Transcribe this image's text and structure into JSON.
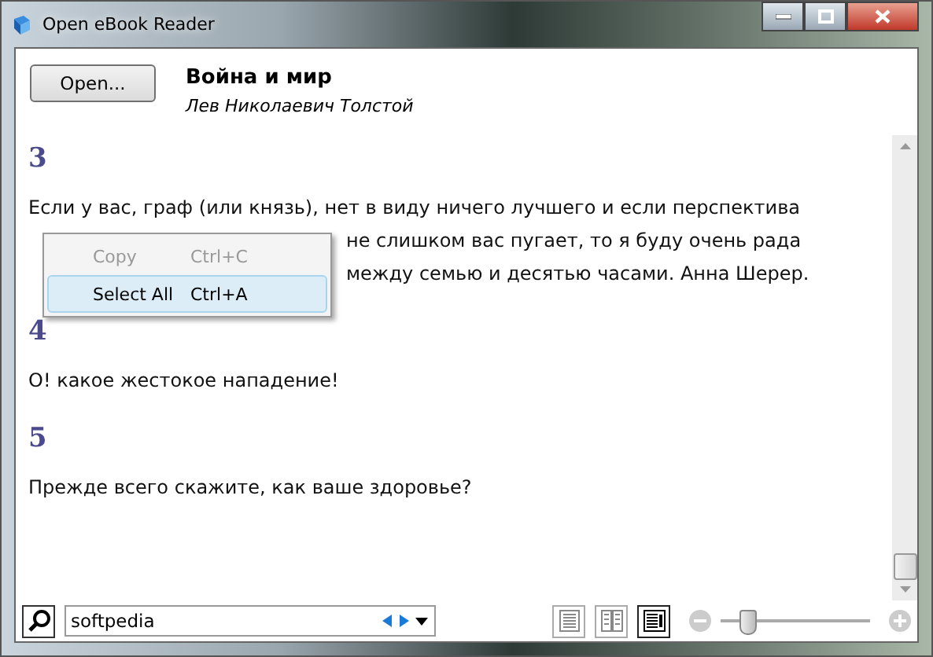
{
  "window": {
    "title": "Open eBook Reader"
  },
  "header": {
    "open_button": "Open...",
    "book_title": "Война и мир",
    "author": "Лев Николаевич Толстой"
  },
  "content": [
    {
      "kind": "heading",
      "text": "3"
    },
    {
      "kind": "paragraph",
      "lines": [
        "Если у вас, граф (или князь), нет в виду ничего лучшего и если перспектива",
        "не слишком вас пугает, то я буду очень рада",
        "между семью и десятью часами. Анна Шерер."
      ]
    },
    {
      "kind": "heading",
      "text": "4"
    },
    {
      "kind": "paragraph",
      "lines": [
        "О! какое жестокое нападение!"
      ]
    },
    {
      "kind": "heading",
      "text": "5"
    },
    {
      "kind": "paragraph",
      "lines": [
        "Прежде всего скажите, как ваше здоровье?"
      ]
    }
  ],
  "context_menu": [
    {
      "label": "Copy",
      "shortcut": "Ctrl+C",
      "disabled": true,
      "selected": false
    },
    {
      "label": "Select All",
      "shortcut": "Ctrl+A",
      "disabled": false,
      "selected": true
    }
  ],
  "search": {
    "value": "softpedia"
  },
  "view_modes": [
    {
      "selected": false
    },
    {
      "selected": false
    },
    {
      "selected": true
    }
  ],
  "zoom": {
    "level": 0.18
  }
}
